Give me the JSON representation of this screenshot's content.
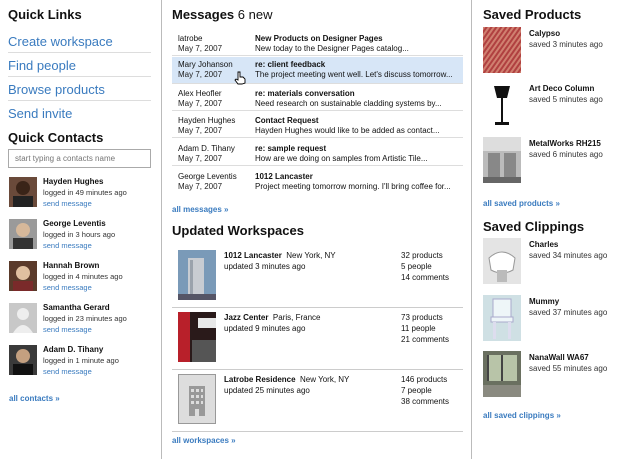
{
  "quick_links": {
    "title": "Quick Links",
    "items": [
      "Create workspace",
      "Find people",
      "Browse products",
      "Send invite"
    ]
  },
  "quick_contacts": {
    "title": "Quick Contacts",
    "search_placeholder": "start typing a contacts name",
    "send_label": "send message",
    "items": [
      {
        "name": "Hayden Hughes",
        "status": "logged in 49 minutes ago"
      },
      {
        "name": "George Leventis",
        "status": "logged in 3 hours ago"
      },
      {
        "name": "Hannah Brown",
        "status": "logged in 4 minutes ago"
      },
      {
        "name": "Samantha Gerard",
        "status": "logged in 23 minutes ago"
      },
      {
        "name": "Adam D. Tihany",
        "status": "logged in 1 minute ago"
      }
    ],
    "all_label": "all contacts  »"
  },
  "messages": {
    "title": "Messages",
    "new_count": "6 new",
    "items": [
      {
        "from": "latrobe",
        "date": "May 7, 2007",
        "subject": "New Products on Designer Pages",
        "preview": "New today to the Designer Pages catalog...",
        "selected": false
      },
      {
        "from": "Mary Johanson",
        "date": "May 7, 2007",
        "subject": "re: client feedback",
        "preview": "The project meeting went well. Let's discuss tomorrow...",
        "selected": true
      },
      {
        "from": "Alex Heofler",
        "date": "May 7, 2007",
        "subject": "re: materials conversation",
        "preview": "Need research on sustainable cladding systems by...",
        "selected": false
      },
      {
        "from": "Hayden Hughes",
        "date": "May 7, 2007",
        "subject": "Contact Request",
        "preview": "Hayden Hughes would like to be added as contact...",
        "selected": false
      },
      {
        "from": "Adam D. Tihany",
        "date": "May 7, 2007",
        "subject": "re: sample request",
        "preview": "How are we doing on samples from Artistic Tile...",
        "selected": false
      },
      {
        "from": "George Leventis",
        "date": "May 7, 2007",
        "subject": "1012 Lancaster",
        "preview": "Project meeting tomorrow morning. I'll bring coffee for...",
        "selected": false
      }
    ],
    "all_label": "all messages  »"
  },
  "workspaces": {
    "title": "Updated Workspaces",
    "items": [
      {
        "name": "1012 Lancaster",
        "location": "New York, NY",
        "updated": "updated 3 minutes ago",
        "products": "32 products",
        "people": "5 people",
        "comments": "14 comments"
      },
      {
        "name": "Jazz Center",
        "location": "Paris, France",
        "updated": "updated 9 minutes ago",
        "products": "73 products",
        "people": "11 people",
        "comments": "21 comments"
      },
      {
        "name": "Latrobe Residence",
        "location": "New York, NY",
        "updated": "updated 25 minutes ago",
        "products": "146 products",
        "people": "7 people",
        "comments": "38 comments"
      }
    ],
    "all_label": "all workspaces  »"
  },
  "saved_products": {
    "title": "Saved Products",
    "items": [
      {
        "name": "Calypso",
        "saved": "saved 3 minutes ago"
      },
      {
        "name": "Art Deco Column",
        "saved": "saved 5 minutes ago"
      },
      {
        "name": "MetalWorks RH215",
        "saved": "saved 6 minutes ago"
      }
    ],
    "all_label": "all saved products  »"
  },
  "saved_clippings": {
    "title": "Saved Clippings",
    "items": [
      {
        "name": "Charles",
        "saved": "saved 34 minutes ago"
      },
      {
        "name": "Mummy",
        "saved": "saved 37 minutes ago"
      },
      {
        "name": "NanaWall WA67",
        "saved": "saved 55 minutes ago"
      }
    ],
    "all_label": "all saved clippings  »"
  },
  "colors": {
    "link": "#3a7bbf",
    "selected_row": "#d7e6f7"
  }
}
